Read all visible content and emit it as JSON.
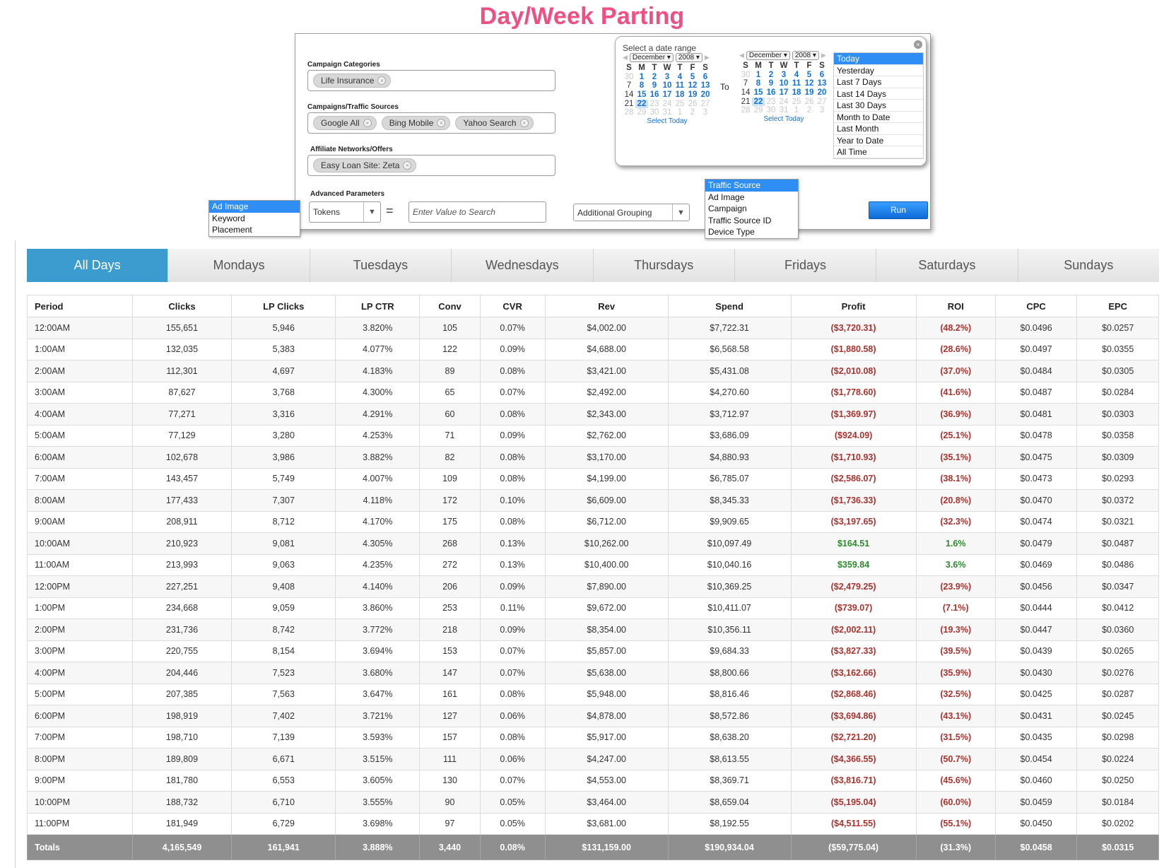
{
  "title": "Day/Week Parting",
  "filters": {
    "campaign_categories": {
      "label": "Campaign Categories",
      "chips": [
        "Life Insurance"
      ]
    },
    "campaigns_traffic": {
      "label": "Campaigns/Traffic Sources",
      "chips": [
        "Google All",
        "Bing Mobile",
        "Yahoo Search"
      ]
    },
    "affiliate": {
      "label": "Affiliate Networks/Offers",
      "chips": [
        "Easy Loan Site: Zeta"
      ]
    },
    "advanced": {
      "label": "Advanced Parameters",
      "tokens_select": "Tokens",
      "equals": "=",
      "search_placeholder": "Enter Value to Search",
      "grouping_select": "Additional Grouping"
    },
    "token_options": [
      "Ad Image",
      "Keyword",
      "Placement"
    ],
    "token_selected": "Ad Image",
    "grouping_options": [
      "Traffic Source",
      "Ad Image",
      "Campaign",
      "Traffic Source ID",
      "Device Type"
    ],
    "grouping_selected": "Traffic Source",
    "run_label": "Run"
  },
  "date_range": {
    "title": "Select a date range",
    "to_label": "To",
    "select_today": "Select Today",
    "from": {
      "month": "December",
      "year": "2008"
    },
    "to": {
      "month": "December",
      "year": "2008"
    },
    "day_names": [
      "S",
      "M",
      "T",
      "W",
      "T",
      "F",
      "S"
    ],
    "weeks": [
      [
        "30",
        "1",
        "2",
        "3",
        "4",
        "5",
        "6"
      ],
      [
        "7",
        "8",
        "9",
        "10",
        "11",
        "12",
        "13"
      ],
      [
        "14",
        "15",
        "16",
        "17",
        "18",
        "19",
        "20"
      ],
      [
        "21",
        "22",
        "23",
        "24",
        "25",
        "26",
        "27"
      ],
      [
        "28",
        "29",
        "30",
        "31",
        "1",
        "2",
        "3"
      ]
    ],
    "selected_day": "22",
    "presets": [
      "Today",
      "Yesterday",
      "Last 7 Days",
      "Last 14 Days",
      "Last 30 Days",
      "Month to Date",
      "Last Month",
      "Year to Date",
      "All Time"
    ],
    "preset_selected": "Today"
  },
  "tabs": [
    "All Days",
    "Mondays",
    "Tuesdays",
    "Wednesdays",
    "Thursdays",
    "Fridays",
    "Saturdays",
    "Sundays"
  ],
  "active_tab": "All Days",
  "table": {
    "columns": [
      "Period",
      "Clicks",
      "LP Clicks",
      "LP CTR",
      "Conv",
      "CVR",
      "Rev",
      "Spend",
      "Profit",
      "ROI",
      "CPC",
      "EPC"
    ],
    "rows": [
      [
        "12:00AM",
        "155,651",
        "5,946",
        "3.820%",
        "105",
        "0.07%",
        "$4,002.00",
        "$7,722.31",
        "($3,720.31)",
        "(48.2%)",
        "$0.0496",
        "$0.0257"
      ],
      [
        "1:00AM",
        "132,035",
        "5,383",
        "4.077%",
        "122",
        "0.09%",
        "$4,688.00",
        "$6,568.58",
        "($1,880.58)",
        "(28.6%)",
        "$0.0497",
        "$0.0355"
      ],
      [
        "2:00AM",
        "112,301",
        "4,697",
        "4.183%",
        "89",
        "0.08%",
        "$3,421.00",
        "$5,431.08",
        "($2,010.08)",
        "(37.0%)",
        "$0.0484",
        "$0.0305"
      ],
      [
        "3:00AM",
        "87,627",
        "3,768",
        "4.300%",
        "65",
        "0.07%",
        "$2,492.00",
        "$4,270.60",
        "($1,778.60)",
        "(41.6%)",
        "$0.0487",
        "$0.0284"
      ],
      [
        "4:00AM",
        "77,271",
        "3,316",
        "4.291%",
        "60",
        "0.08%",
        "$2,343.00",
        "$3,712.97",
        "($1,369.97)",
        "(36.9%)",
        "$0.0481",
        "$0.0303"
      ],
      [
        "5:00AM",
        "77,129",
        "3,280",
        "4.253%",
        "71",
        "0.09%",
        "$2,762.00",
        "$3,686.09",
        "($924.09)",
        "(25.1%)",
        "$0.0478",
        "$0.0358"
      ],
      [
        "6:00AM",
        "102,678",
        "3,986",
        "3.882%",
        "82",
        "0.08%",
        "$3,170.00",
        "$4,880.93",
        "($1,710.93)",
        "(35.1%)",
        "$0.0475",
        "$0.0309"
      ],
      [
        "7:00AM",
        "143,457",
        "5,749",
        "4.007%",
        "109",
        "0.08%",
        "$4,199.00",
        "$6,785.07",
        "($2,586.07)",
        "(38.1%)",
        "$0.0473",
        "$0.0293"
      ],
      [
        "8:00AM",
        "177,433",
        "7,307",
        "4.118%",
        "172",
        "0.10%",
        "$6,609.00",
        "$8,345.33",
        "($1,736.33)",
        "(20.8%)",
        "$0.0470",
        "$0.0372"
      ],
      [
        "9:00AM",
        "208,911",
        "8,712",
        "4.170%",
        "175",
        "0.08%",
        "$6,712.00",
        "$9,909.65",
        "($3,197.65)",
        "(32.3%)",
        "$0.0474",
        "$0.0321"
      ],
      [
        "10:00AM",
        "210,923",
        "9,081",
        "4.305%",
        "268",
        "0.13%",
        "$10,262.00",
        "$10,097.49",
        "$164.51",
        "1.6%",
        "$0.0479",
        "$0.0487"
      ],
      [
        "11:00AM",
        "213,993",
        "9,063",
        "4.235%",
        "272",
        "0.13%",
        "$10,400.00",
        "$10,040.16",
        "$359.84",
        "3.6%",
        "$0.0469",
        "$0.0486"
      ],
      [
        "12:00PM",
        "227,251",
        "9,408",
        "4.140%",
        "206",
        "0.09%",
        "$7,890.00",
        "$10,369.25",
        "($2,479.25)",
        "(23.9%)",
        "$0.0456",
        "$0.0347"
      ],
      [
        "1:00PM",
        "234,668",
        "9,059",
        "3.860%",
        "253",
        "0.11%",
        "$9,672.00",
        "$10,411.07",
        "($739.07)",
        "(7.1%)",
        "$0.0444",
        "$0.0412"
      ],
      [
        "2:00PM",
        "231,736",
        "8,742",
        "3.772%",
        "218",
        "0.09%",
        "$8,354.00",
        "$10,356.11",
        "($2,002.11)",
        "(19.3%)",
        "$0.0447",
        "$0.0360"
      ],
      [
        "3:00PM",
        "220,755",
        "8,154",
        "3.694%",
        "153",
        "0.07%",
        "$5,857.00",
        "$9,684.33",
        "($3,827.33)",
        "(39.5%)",
        "$0.0439",
        "$0.0265"
      ],
      [
        "4:00PM",
        "204,446",
        "7,523",
        "3.680%",
        "147",
        "0.07%",
        "$5,638.00",
        "$8,800.66",
        "($3,162.66)",
        "(35.9%)",
        "$0.0430",
        "$0.0276"
      ],
      [
        "5:00PM",
        "207,385",
        "7,563",
        "3.647%",
        "161",
        "0.08%",
        "$5,948.00",
        "$8,816.46",
        "($2,868.46)",
        "(32.5%)",
        "$0.0425",
        "$0.0287"
      ],
      [
        "6:00PM",
        "198,919",
        "7,402",
        "3.721%",
        "127",
        "0.06%",
        "$4,878.00",
        "$8,572.86",
        "($3,694.86)",
        "(43.1%)",
        "$0.0431",
        "$0.0245"
      ],
      [
        "7:00PM",
        "198,710",
        "7,139",
        "3.593%",
        "157",
        "0.08%",
        "$5,917.00",
        "$8,638.20",
        "($2,721.20)",
        "(31.5%)",
        "$0.0435",
        "$0.0298"
      ],
      [
        "8:00PM",
        "189,809",
        "6,671",
        "3.515%",
        "111",
        "0.06%",
        "$4,247.00",
        "$8,613.55",
        "($4,366.55)",
        "(50.7%)",
        "$0.0454",
        "$0.0224"
      ],
      [
        "9:00PM",
        "181,780",
        "6,553",
        "3.605%",
        "130",
        "0.07%",
        "$4,553.00",
        "$8,369.71",
        "($3,816.71)",
        "(45.6%)",
        "$0.0460",
        "$0.0250"
      ],
      [
        "10:00PM",
        "188,732",
        "6,710",
        "3.555%",
        "90",
        "0.05%",
        "$3,464.00",
        "$8,659.04",
        "($5,195.04)",
        "(60.0%)",
        "$0.0459",
        "$0.0184"
      ],
      [
        "11:00PM",
        "181,949",
        "6,729",
        "3.698%",
        "97",
        "0.05%",
        "$3,681.00",
        "$8,192.55",
        "($4,511.55)",
        "(55.1%)",
        "$0.0450",
        "$0.0202"
      ]
    ],
    "totals": [
      "Totals",
      "4,165,549",
      "161,941",
      "3.888%",
      "3,440",
      "0.08%",
      "$131,159.00",
      "$190,934.04",
      "($59,775.04)",
      "(31.3%)",
      "$0.0458",
      "$0.0315"
    ]
  },
  "colors": {
    "title": "#ef4f82",
    "tab_active": "#3c9ccf",
    "negative": "#a8332e",
    "positive": "#2e8a2e",
    "selection": "#2f8ef4"
  }
}
